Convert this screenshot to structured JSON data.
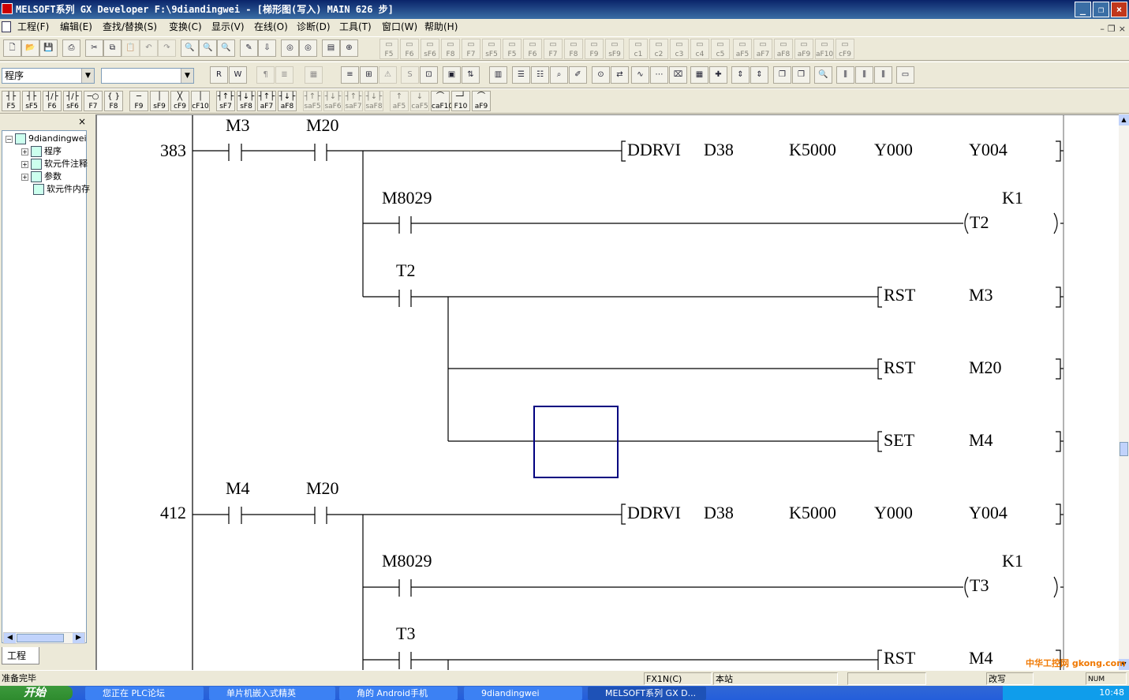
{
  "window": {
    "title": "MELSOFT系列 GX Developer F:\\9diandingwei - [梯形图(写入)      MAIN      626 步]"
  },
  "menu": [
    "工程(F)",
    "编辑(E)",
    "查找/替换(S)",
    "变换(C)",
    "显示(V)",
    "在线(O)",
    "诊断(D)",
    "工具(T)",
    "窗口(W)",
    "帮助(H)"
  ],
  "toolbar3": {
    "program_select": "程序",
    "device_select": ""
  },
  "fkeys": [
    "F5",
    "sF5",
    "F6",
    "sF6",
    "F7",
    "F8",
    "F9",
    "sF9",
    "cF9",
    "cF10",
    "sF7",
    "sF8",
    "aF7",
    "aF8",
    "saF5",
    "saF6",
    "saF7",
    "saF8",
    "aF5",
    "caF5",
    "caF10",
    "F10",
    "aF9"
  ],
  "tb2_keys": [
    "F5",
    "F6",
    "sF6",
    "F8",
    "F7",
    "sF5",
    "F5",
    "F6",
    "F7",
    "F8",
    "F9",
    "sF9",
    "c1",
    "c2",
    "c3",
    "c4",
    "c5",
    "aF5",
    "aF7",
    "aF8",
    "aF9",
    "aF10",
    "cF9"
  ],
  "project": {
    "close": "×",
    "tab": "工程",
    "tree": [
      {
        "label": "9diandingwei",
        "toggle": "−"
      },
      {
        "label": "程序",
        "toggle": "+"
      },
      {
        "label": "软元件注释",
        "toggle": "+"
      },
      {
        "label": "参数",
        "toggle": "+"
      },
      {
        "label": "软元件内存",
        "toggle": ""
      }
    ]
  },
  "ladder": {
    "rung1": {
      "step": "383",
      "c_m3": "M3",
      "c_m20": "M20",
      "ddrvi": [
        "DDRVI",
        "D38",
        "K5000",
        "Y000",
        "Y004"
      ],
      "m8029": "M8029",
      "k1": "K1",
      "t2": "T2",
      "t2_contact": "T2",
      "rst1": [
        "RST",
        "M3"
      ],
      "rst2": [
        "RST",
        "M20"
      ],
      "set": [
        "SET",
        "M4"
      ]
    },
    "rung2": {
      "step": "412",
      "c_m4": "M4",
      "c_m20": "M20",
      "ddrvi": [
        "DDRVI",
        "D38",
        "K5000",
        "Y000",
        "Y004"
      ],
      "m8029": "M8029",
      "k1": "K1",
      "t3": "T3",
      "t3_contact": "T3",
      "rst": [
        "RST",
        "M4"
      ]
    }
  },
  "status": {
    "message": "准备完毕",
    "plc": "FX1N(C)",
    "station": "本站",
    "mode": "改写",
    "num": "NUM"
  },
  "taskbar": {
    "start": "开始",
    "tasks": [
      "您正在  PLC论坛",
      "单片机嵌入式精英",
      "角的  Android手机",
      "9diandingwei",
      "MELSOFT系列 GX D..."
    ],
    "clock": "10:48"
  },
  "watermark": "中华工控网 gkong.com"
}
